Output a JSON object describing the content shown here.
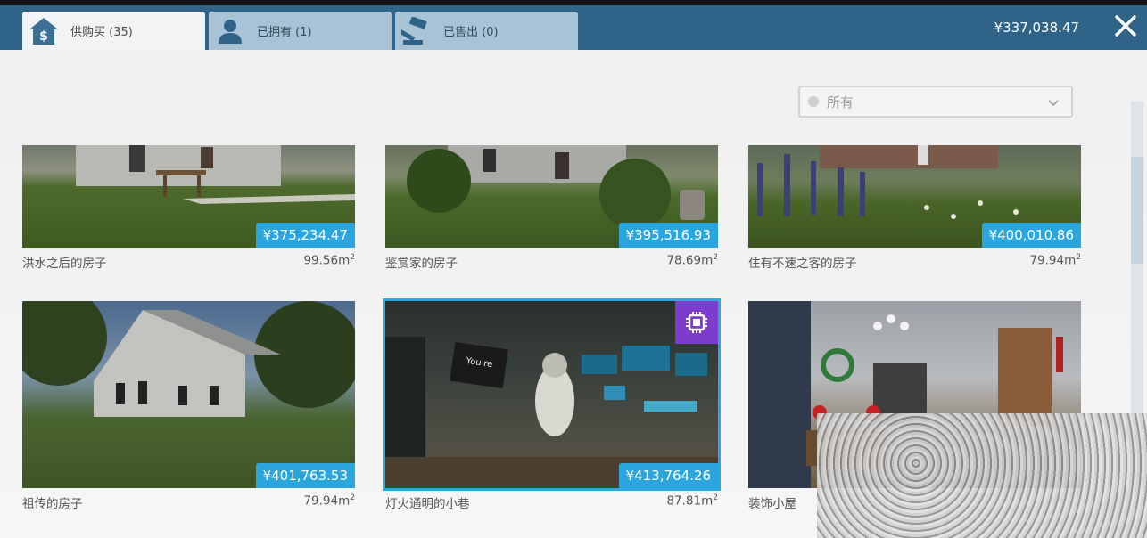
{
  "header": {
    "tabs": [
      {
        "label": "供购买 (35)",
        "icon": "house-dollar-icon",
        "active": true
      },
      {
        "label": "已拥有 (1)",
        "icon": "person-icon",
        "active": false
      },
      {
        "label": "已售出 (0)",
        "icon": "gavel-icon",
        "active": false
      }
    ],
    "balance": "¥337,038.47",
    "close_icon": "close-icon"
  },
  "filter": {
    "selected": "所有"
  },
  "listings": [
    {
      "name": "洪水之后的房子",
      "price": "¥375,234.47",
      "area": "99.56m",
      "unit_sup": "2"
    },
    {
      "name": "鉴赏家的房子",
      "price": "¥395,516.93",
      "area": "78.69m",
      "unit_sup": "2"
    },
    {
      "name": "住有不速之客的房子",
      "price": "¥400,010.86",
      "area": "79.94m",
      "unit_sup": "2"
    },
    {
      "name": "祖传的房子",
      "price": "¥401,763.53",
      "area": "79.94m",
      "unit_sup": "2"
    },
    {
      "name": "灯火通明的小巷",
      "price": "¥413,764.26",
      "area": "87.81m",
      "unit_sup": "2",
      "badge": "chip-icon"
    },
    {
      "name": "装饰小屋",
      "price": "",
      "area": "",
      "unit_sup": ""
    }
  ],
  "colors": {
    "header": "#2f6488",
    "accent": "#2aa5de",
    "badge": "#7c3ccc"
  }
}
